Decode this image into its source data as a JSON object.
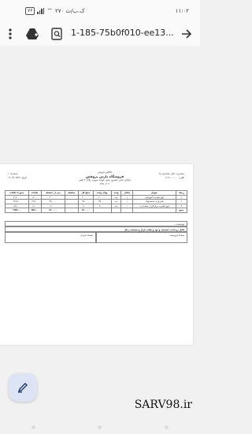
{
  "status": {
    "time": "۱۱:۰۲",
    "network": "۲۷۰ ک.ب/ث",
    "battery": "۷۶"
  },
  "toolbar": {
    "url": "1-185-75b0f010-ee13...",
    "icons": [
      "more-vert-icon",
      "drive-add-icon",
      "search-doc-icon",
      "forward-arrow-icon"
    ]
  },
  "doc": {
    "seller_label": "فاکتور فروش",
    "store_name": "فروشگاه پارس پژوهش",
    "address": "خیابان ناصر خسرو، نیش کوچه مروی، پلاک ۲ تلفن ۷۶۷۰۷۰۹",
    "customer": "مشتری: علی محمدی نیا",
    "phone": "تلفن: ۰۹۱۲۰۰۰۰۰۰",
    "number": "شماره: ۱",
    "date": "تاریخ: ۱۴۰۳/۰۳/۲۷",
    "columns": [
      "ردیف",
      "عنوان",
      "مقدار",
      "واحد",
      "بهای واحد",
      "مبلغ کل",
      "تخفیف",
      "پس از تخفیف",
      "مالیات",
      "جمع با مالیات"
    ],
    "rows": [
      [
        "۱",
        "لوح فشرده آموزشی",
        "۱",
        "عدد",
        "۲۰۰۰۰۰",
        "۲۰۰۰۰۰",
        "۰",
        "۲۰۰۰۰۰",
        "۱۸۰۰۰",
        "۲۱۸۰۰۰"
      ],
      [
        "۲",
        "هندزفری سامسونگ",
        "۱",
        "عدد",
        "۳۵۰۰۰۰",
        "۳۵۰۰۰۰",
        "۰",
        "۳۵۰۰۰۰",
        "۳۱۵۰۰",
        "۳۸۱۵۰۰"
      ],
      [
        "۳",
        "لوح فشرده نرم افزار حسابداری",
        "۱",
        "عدد",
        "۹۰۰۰۰",
        "۹۰۰۰۰",
        "۰",
        "۹۰۰۰۰",
        "۸۱۰۰",
        "۹۸۱۰۰"
      ]
    ],
    "totals": [
      "جمع",
      "",
      "",
      "",
      "",
      "۶۴۰۰۰۰",
      "۰",
      "۶۴۰۰۰۰",
      "۵۷۶۰۰",
      "۶۹۷۶۰۰"
    ],
    "notes_label": "توضیحات: -",
    "sum_words": "قابل پرداخت: ششصد و نود و هفت هزار و ششصد ریال",
    "seller_sign": "امضاء فروشنده",
    "buyer_sign": "امضاء خریدار"
  },
  "watermark": "SARV98.ir"
}
